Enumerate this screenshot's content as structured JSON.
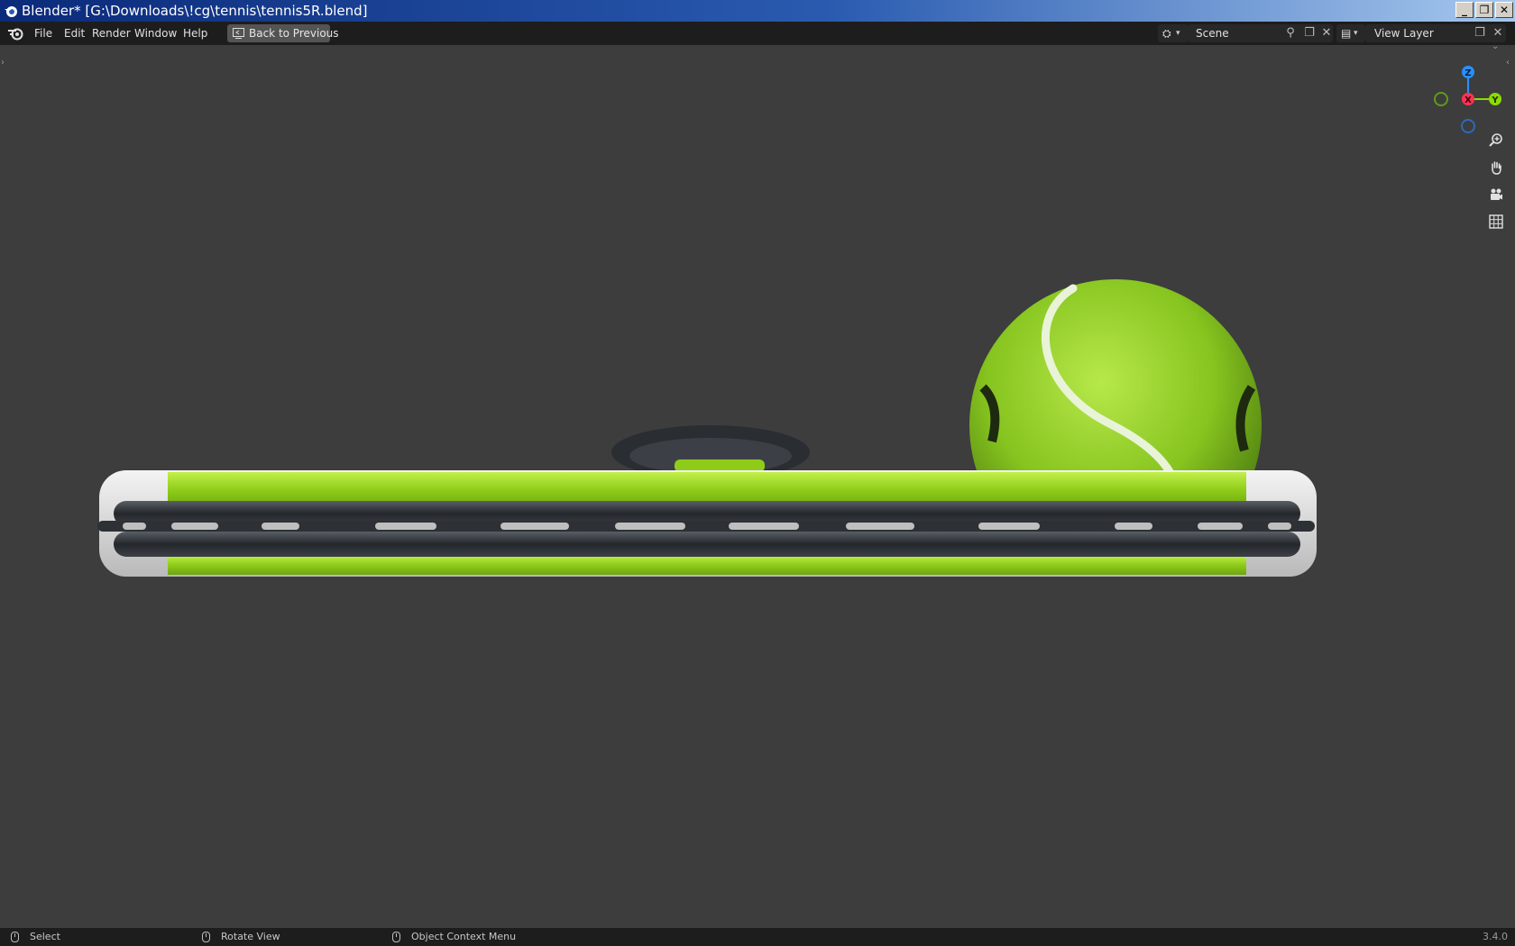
{
  "window": {
    "title": "Blender* [G:\\Downloads\\!cg\\tennis\\tennis5R.blend]",
    "buttons": {
      "minimize": "_",
      "maximize": "❐",
      "close": "✕"
    }
  },
  "menu": {
    "items": [
      "File",
      "Edit",
      "Render",
      "Window",
      "Help"
    ],
    "back_to_previous": "Back to Previous"
  },
  "scene_selector": {
    "value": "Scene",
    "icon": "scene-icon"
  },
  "view_layer_selector": {
    "value": "View Layer",
    "icon": "render-layer-icon"
  },
  "gizmo": {
    "z": "Z",
    "x": "X",
    "y": "Y"
  },
  "nav_tools": [
    "zoom-icon",
    "hand-pan-icon",
    "camera-icon",
    "ortho-grid-icon"
  ],
  "status": {
    "select": "Select",
    "rotate": "Rotate View",
    "context_menu": "Object Context Menu",
    "version": "3.4.0"
  },
  "colors": {
    "viewport_bg": "#3d3d3d",
    "header_bg": "#1d1d1d",
    "racket_green": "#8fcc1a",
    "axis_x": "#ff3352",
    "axis_y": "#8bdc00",
    "axis_z": "#2890ff"
  }
}
